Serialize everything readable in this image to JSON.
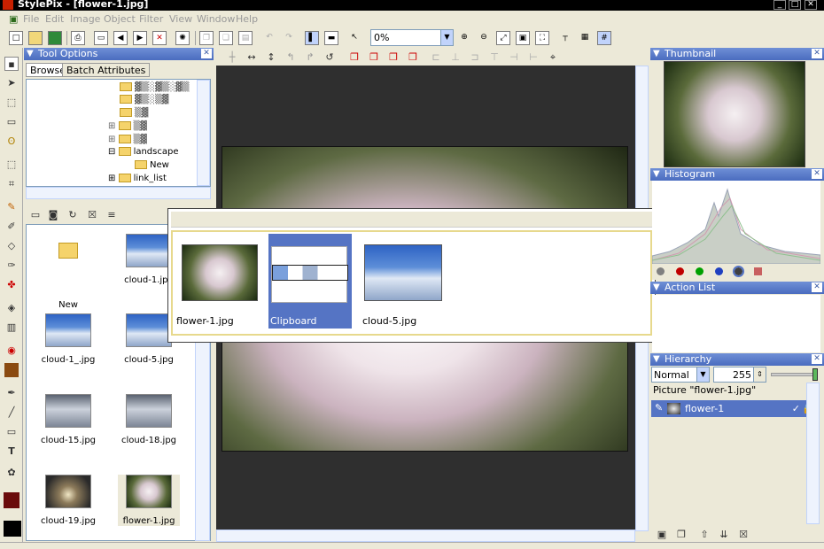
{
  "window": {
    "title": "StylePix - [flower-1.jpg]"
  },
  "menu": [
    "File",
    "Edit",
    "Image",
    "Object",
    "Filter",
    "View",
    "Window",
    "Help"
  ],
  "toolbar": {
    "zoom_value": "0%"
  },
  "tool_options": {
    "title": "Tool Options",
    "tabs": [
      "Browse",
      "Batch Attributes"
    ]
  },
  "tree": {
    "items": [
      {
        "label": "landscape",
        "expanded": true
      },
      {
        "label": "New",
        "indent": true
      },
      {
        "label": "link_list",
        "expanded": false
      }
    ]
  },
  "files": [
    {
      "name": "New",
      "kind": "folder"
    },
    {
      "name": "cloud-1.jpg",
      "kind": "sky"
    },
    {
      "name": "cloud-1_.jpg",
      "kind": "sky"
    },
    {
      "name": "cloud-5.jpg",
      "kind": "sky"
    },
    {
      "name": "cloud-15.jpg",
      "kind": "storm"
    },
    {
      "name": "cloud-18.jpg",
      "kind": "storm"
    },
    {
      "name": "cloud-19.jpg",
      "kind": "sunset"
    },
    {
      "name": "flower-1.jpg",
      "kind": "flower"
    }
  ],
  "clipboard": {
    "items": [
      "flower-1.jpg",
      "Clipboard",
      "cloud-5.jpg"
    ]
  },
  "thumbnail": {
    "title": "Thumbnail"
  },
  "histogram": {
    "title": "Histogram",
    "channel_colors": [
      "#808080",
      "#c00000",
      "#00a000",
      "#2040c0",
      "#404040"
    ]
  },
  "action_list": {
    "title": "Action List"
  },
  "hierarchy": {
    "title": "Hierarchy",
    "blend_mode": "Normal",
    "opacity": "255",
    "picture_label": "Picture \"flower-1.jpg\"",
    "layer_name": "flower-1"
  }
}
